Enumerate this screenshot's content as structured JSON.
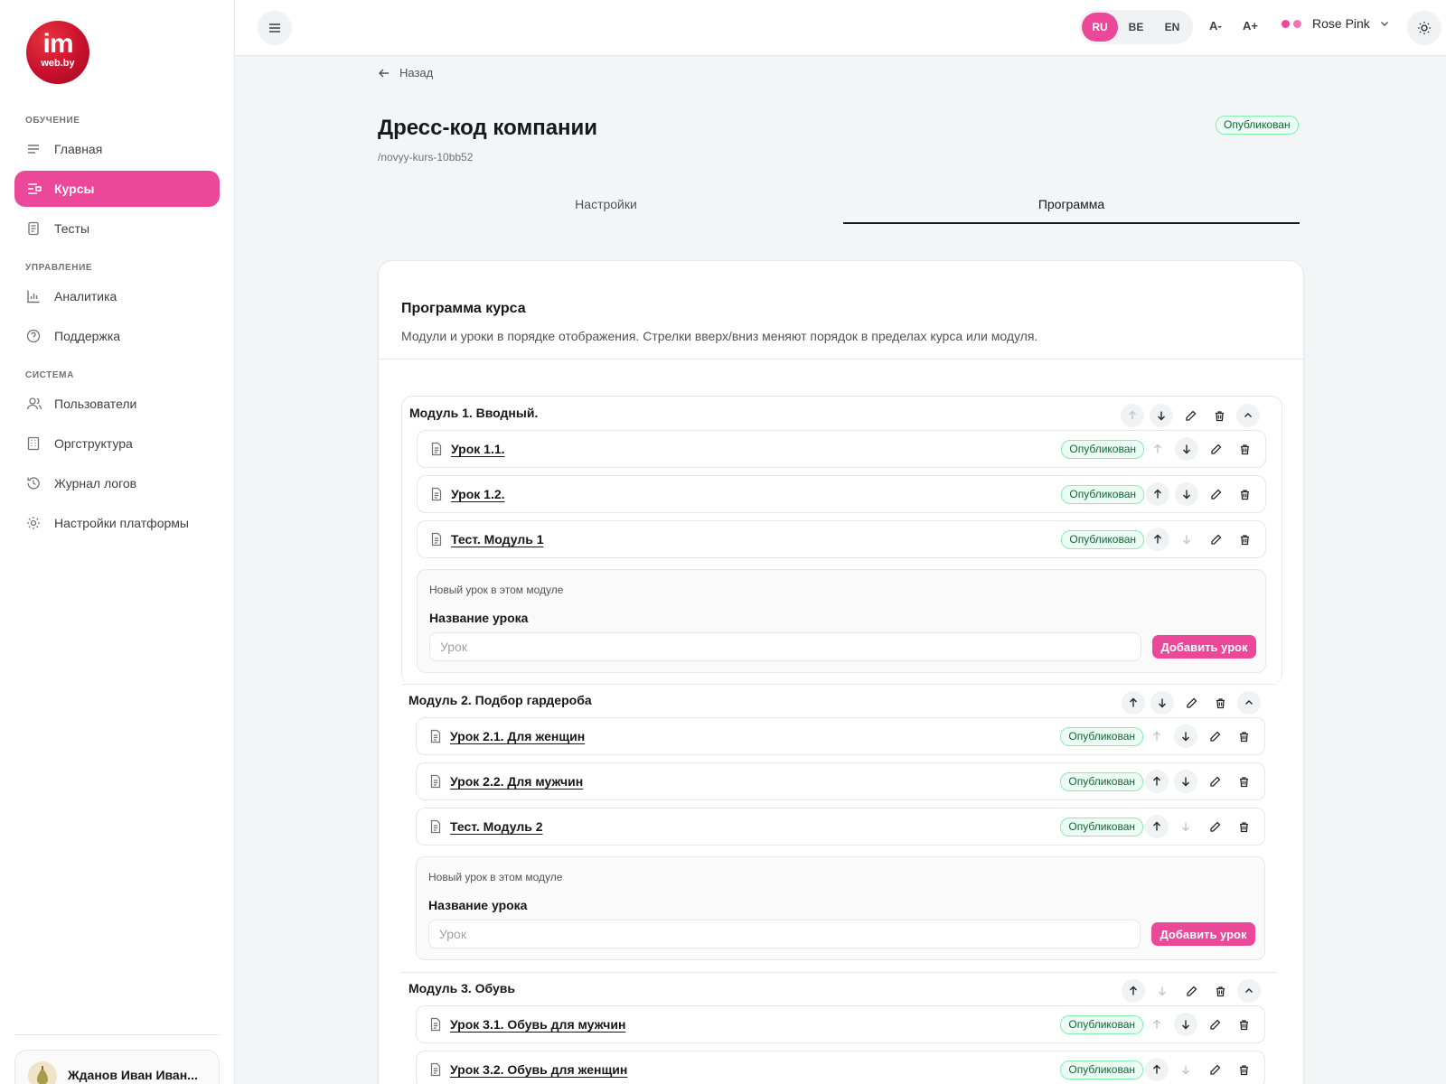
{
  "brand": {
    "logo_main": "im",
    "logo_sub": "web.by"
  },
  "sidebar": {
    "sections": [
      {
        "label": "ОБУЧЕНИЕ"
      },
      {
        "label": "УПРАВЛЕНИЕ"
      },
      {
        "label": "СИСТЕМА"
      }
    ],
    "items": [
      {
        "label": "Главная",
        "icon": "home-lines-icon"
      },
      {
        "label": "Курсы",
        "icon": "courses-icon",
        "active": true
      },
      {
        "label": "Тесты",
        "icon": "tests-icon"
      },
      {
        "label": "Аналитика",
        "icon": "analytics-icon"
      },
      {
        "label": "Поддержка",
        "icon": "support-icon"
      },
      {
        "label": "Пользователи",
        "icon": "users-icon"
      },
      {
        "label": "Оргструктура",
        "icon": "org-structure-icon"
      },
      {
        "label": "Журнал логов",
        "icon": "history-icon"
      },
      {
        "label": "Настройки платформы",
        "icon": "settings-icon"
      }
    ],
    "user": {
      "name": "Жданов Иван Иван..."
    }
  },
  "topbar": {
    "languages": [
      "RU",
      "BE",
      "EN"
    ],
    "active_language": "RU",
    "font_decrease": "A-",
    "font_increase": "A+",
    "theme_name": "Rose Pink",
    "theme_colors": [
      "#ec4899",
      "#f472b6"
    ]
  },
  "page": {
    "back": "Назад",
    "title": "Дресс-код компании",
    "slug": "/novyy-kurs-10bb52",
    "status": "Опубликован",
    "tabs": [
      "Настройки",
      "Программа"
    ],
    "active_tab": "Программа"
  },
  "program": {
    "title": "Программа курса",
    "description": "Модули и уроки в порядке отображения. Стрелки вверх/вниз меняют порядок в пределах курса или модуля.",
    "new_lesson_hint": "Новый урок в этом модуле",
    "lesson_name_label": "Название урока",
    "lesson_placeholder": "Урок",
    "add_lesson": "Добавить урок",
    "modules": [
      {
        "title": "Модуль 1. Вводный.",
        "lessons": [
          {
            "title": "Урок 1.1.",
            "status": "Опубликован"
          },
          {
            "title": "Урок 1.2.",
            "status": "Опубликован"
          },
          {
            "title": "Тест. Модуль 1",
            "status": "Опубликован"
          }
        ]
      },
      {
        "title": "Модуль 2. Подбор гардероба",
        "lessons": [
          {
            "title": "Урок 2.1. Для женщин",
            "status": "Опубликован"
          },
          {
            "title": "Урок 2.2. Для мужчин",
            "status": "Опубликован"
          },
          {
            "title": "Тест. Модуль 2",
            "status": "Опубликован"
          }
        ]
      },
      {
        "title": "Модуль 3. Обувь",
        "lessons": [
          {
            "title": "Урок 3.1. Обувь для мужчин",
            "status": "Опубликован"
          },
          {
            "title": "Урок 3.2. Обувь для женщин",
            "status": "Опубликован"
          }
        ]
      }
    ]
  },
  "colors": {
    "accent": "#ec4899",
    "published_bg": "#ecfdf5",
    "published_border": "#86efac",
    "published_text": "#166534"
  }
}
